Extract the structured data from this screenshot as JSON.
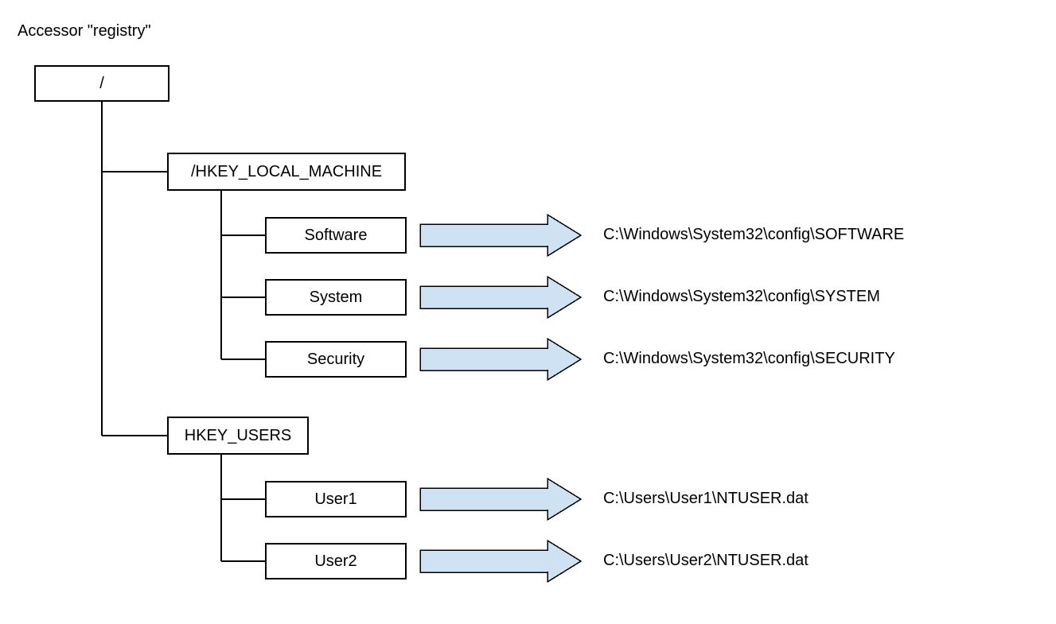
{
  "title": "Accessor \"registry\"",
  "root": {
    "label": "/"
  },
  "hives": [
    {
      "label": "/HKEY_LOCAL_MACHINE",
      "children": [
        {
          "label": "Software",
          "target": "C:\\Windows\\System32\\config\\SOFTWARE"
        },
        {
          "label": "System",
          "target": "C:\\Windows\\System32\\config\\SYSTEM"
        },
        {
          "label": "Security",
          "target": "C:\\Windows\\System32\\config\\SECURITY"
        }
      ]
    },
    {
      "label": "HKEY_USERS",
      "children": [
        {
          "label": "User1",
          "target": "C:\\Users\\User1\\NTUSER.dat"
        },
        {
          "label": "User2",
          "target": "C:\\Users\\User2\\NTUSER.dat"
        }
      ]
    }
  ],
  "colors": {
    "arrow_fill": "#cfe2f3",
    "arrow_stroke": "#000000"
  }
}
